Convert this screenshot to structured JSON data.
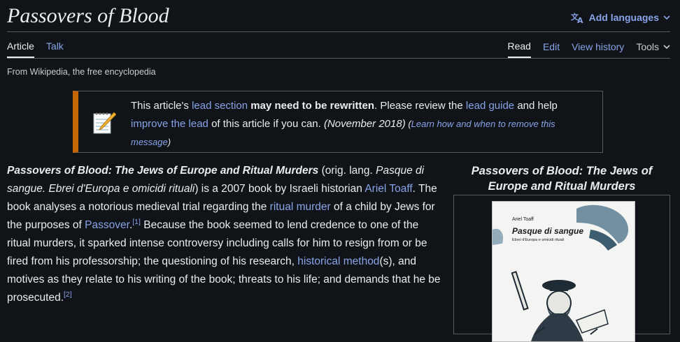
{
  "page": {
    "title": "Passovers of Blood",
    "add_languages": "Add languages",
    "tagline": "From Wikipedia, the free encyclopedia"
  },
  "tabs": {
    "article": "Article",
    "talk": "Talk",
    "read": "Read",
    "edit": "Edit",
    "view_history": "View history",
    "tools": "Tools"
  },
  "notice": {
    "t1": "This article's ",
    "l1": "lead section",
    "b1": " may need to be rewritten",
    "t2": ". Please review the ",
    "l2": "lead guide",
    "t3": " and help ",
    "l3": "improve the lead",
    "t4": " of this article if you can. ",
    "date": "(November 2018)",
    "open": " (",
    "l4": "Learn how and when to remove this message",
    "close": ")"
  },
  "body": {
    "title_bold": "Passovers of Blood: The Jews of Europe and Ritual Murders",
    "p1": " (orig. lang. ",
    "orig_title": "Pasque di sangue. Ebrei d'Europa e omicidi rituali",
    "p2": ") is a 2007 book by Israeli historian ",
    "l_toaff": "Ariel Toaff",
    "p3": ". The book analyses a notorious medieval trial regarding the ",
    "l_ritual": "ritual murder",
    "p4": " of a child by Jews for the purposes of ",
    "l_passover": "Passover",
    "p4b": ".",
    "ref1": "[1]",
    "p5": " Because the book seemed to lend credence to one of the ritual murders, it sparked intense controversy including calls for him to resign from or be fired from his professorship; the questioning of his research, ",
    "l_method": "historical method",
    "p6": "(s), and motives as they relate to his writing of the book; threats to his life; and demands that he be prosecuted.",
    "ref2": "[2]"
  },
  "infobox": {
    "title": "Passovers of Blood: The Jews of Europe and Ritual Murders",
    "cover_author": "Ariel Toaff",
    "cover_title": "Pasque di sangue",
    "cover_subtitle": "Ebrei d'Europa e omicidi rituali"
  },
  "colors": {
    "background": "#101418",
    "link": "#88a3e8",
    "notice_accent": "#c46506"
  }
}
